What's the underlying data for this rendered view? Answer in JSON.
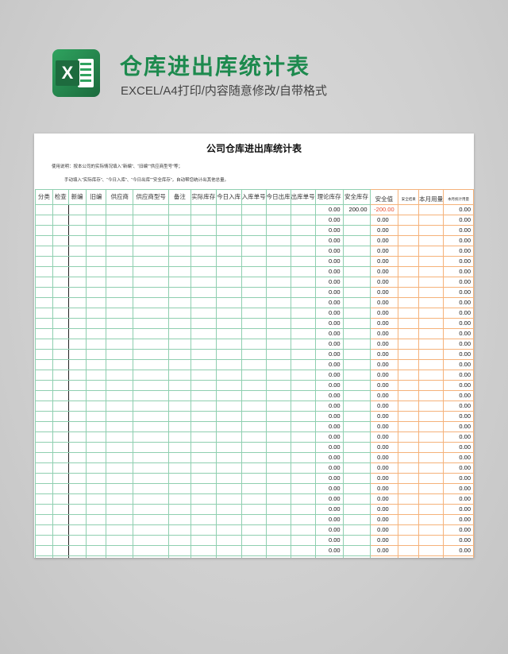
{
  "header": {
    "title": "仓库进出库统计表",
    "subtitle": "EXCEL/A4打印/内容随意修改/自带格式",
    "logo_icon": "excel-icon",
    "logo_letter": "X"
  },
  "document": {
    "title": "公司仓库进出库统计表",
    "note_line1": "使用说明：按本公司的实际情况填入“新编”、“旧编”“供应商型号”等；",
    "note_line2": "手动填入“实际库存”、“今日入库”、“今日出库”“安全库存”，自动帮您统计出其他总量。"
  },
  "table": {
    "columns": [
      "分类",
      "检查",
      "新编",
      "旧编",
      "供应商",
      "供应商型号",
      "备注",
      "实际库存",
      "今日入库",
      "入库单号",
      "今日出库",
      "出库单号",
      "理论库存",
      "安全库存"
    ],
    "summary_columns": [
      "安全值",
      "安全结果",
      "本月用量",
      "本月统计用量"
    ],
    "first_row": {
      "theory": "0.00",
      "safety": "200.00",
      "safe_value": "-200.00",
      "month_total": "0.00"
    },
    "row_values": {
      "theory": "0.00",
      "safe_value": "0.00",
      "month_total": "0.00"
    },
    "row_count": 36,
    "colors": {
      "green_border": "#8fcfb0",
      "orange_border": "#f5b27a",
      "negative": "#e84a2c"
    }
  }
}
